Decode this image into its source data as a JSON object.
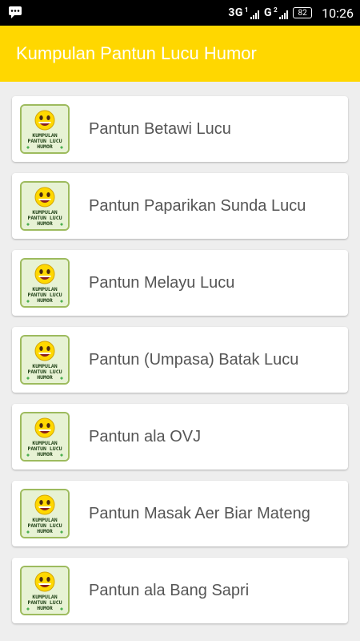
{
  "status_bar": {
    "network1": "3G",
    "network2": "G",
    "sim1": "1",
    "sim2": "2",
    "battery": "82",
    "time": "10:26",
    "notification_icon": "chat-icon"
  },
  "app": {
    "title": "Kumpulan Pantun Lucu Humor",
    "accent_color": "#ffd700"
  },
  "items": [
    {
      "label": "Pantun Betawi Lucu",
      "icon": "pantun-app-icon"
    },
    {
      "label": "Pantun Paparikan Sunda Lucu",
      "icon": "pantun-app-icon"
    },
    {
      "label": "Pantun Melayu Lucu",
      "icon": "pantun-app-icon"
    },
    {
      "label": "Pantun (Umpasa) Batak Lucu",
      "icon": "pantun-app-icon"
    },
    {
      "label": "Pantun ala OVJ",
      "icon": "pantun-app-icon"
    },
    {
      "label": "Pantun Masak Aer Biar Mateng",
      "icon": "pantun-app-icon"
    },
    {
      "label": "Pantun ala Bang Sapri",
      "icon": "pantun-app-icon"
    }
  ],
  "icon_text": {
    "line1": "KUMPULAN",
    "line2": "PANTUN LUCU",
    "line3": "HUMOR"
  }
}
